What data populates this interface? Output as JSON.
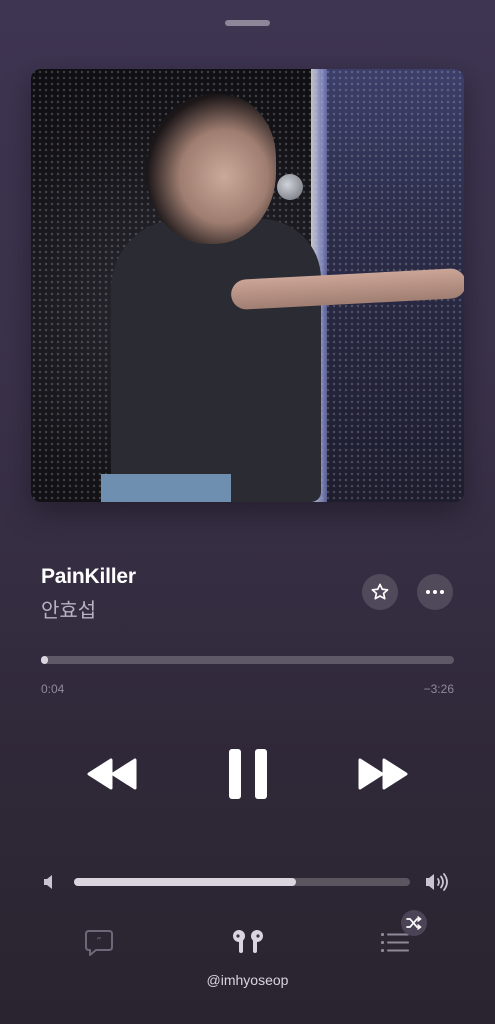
{
  "now_playing": {
    "title": "PainKiller",
    "artist": "안효섭",
    "elapsed": "0:04",
    "remaining": "−3:26",
    "progress_fraction": 0.018,
    "volume_fraction": 0.66
  },
  "playback": {
    "state": "playing",
    "controls": [
      "rewind-icon",
      "pause-icon",
      "fast-forward-icon"
    ]
  },
  "footer": {
    "device_label": "@imhyoseop",
    "icons": [
      "lyrics-icon",
      "airpods-icon",
      "queue-icon",
      "shuffle-icon"
    ]
  },
  "colors": {
    "background_top": "#3e3552",
    "background_bottom": "#2a2430",
    "track": "#d9d6df",
    "secondary_text": "#b8b2c2"
  }
}
